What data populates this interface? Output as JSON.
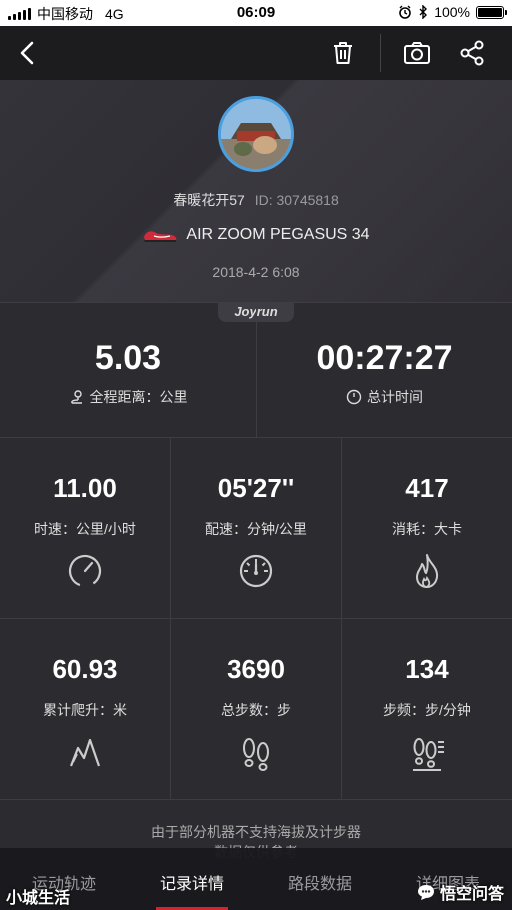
{
  "status_bar": {
    "carrier": "中国移动",
    "network": "4G",
    "time": "06:09",
    "battery": "100%"
  },
  "nav": {
    "back_icon": "chevron-left-icon",
    "delete_icon": "trash-icon",
    "camera_icon": "camera-icon",
    "share_icon": "share-icon"
  },
  "profile": {
    "username": "春暖花开57",
    "user_id": "ID: 30745818",
    "shoe": "AIR ZOOM PEGASUS 34",
    "date": "2018-4-2 6:08",
    "brand": "Joyrun"
  },
  "summary": {
    "distance_value": "5.03",
    "distance_label": "全程距离：公里",
    "time_value": "00:27:27",
    "time_label": "总计时间"
  },
  "stats_row1": [
    {
      "value": "11.00",
      "label": "时速：公里/小时",
      "icon": "speedometer-icon"
    },
    {
      "value": "05'27''",
      "label": "配速：分钟/公里",
      "icon": "gauge-icon"
    },
    {
      "value": "417",
      "label": "消耗：大卡",
      "icon": "flame-icon"
    }
  ],
  "stats_row2": [
    {
      "value": "60.93",
      "label": "累计爬升：米",
      "icon": "climb-icon"
    },
    {
      "value": "3690",
      "label": "总步数：步",
      "icon": "footprints-icon"
    },
    {
      "value": "134",
      "label": "步频：步/分钟",
      "icon": "cadence-icon"
    }
  ],
  "note": {
    "line1": "由于部分机器不支持海拔及计步器",
    "line2": "数据仅供参考"
  },
  "tabs": [
    {
      "label": "运动轨迹"
    },
    {
      "label": "记录详情"
    },
    {
      "label": "路段数据"
    },
    {
      "label": "详细图表"
    }
  ],
  "watermark": {
    "left": "小城生活",
    "right": "悟空问答"
  },
  "colors": {
    "accent_red": "#d0252e",
    "avatar_ring": "#4a9fe0",
    "background": "#2c2c30"
  }
}
